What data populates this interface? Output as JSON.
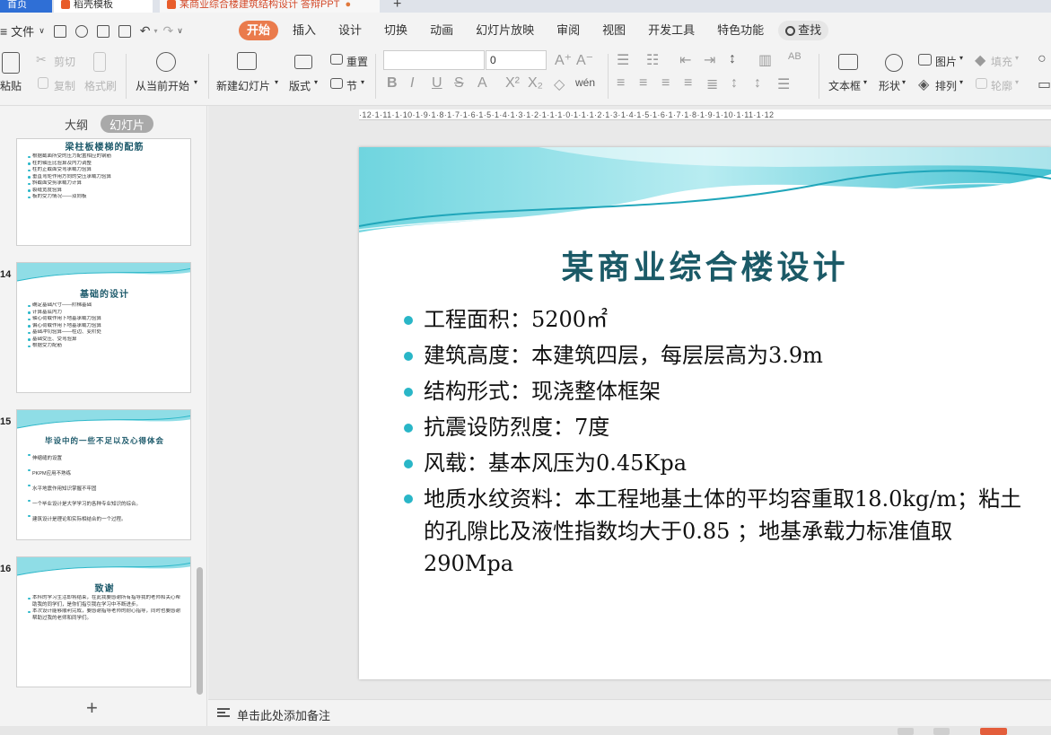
{
  "window": {
    "tabs": [
      {
        "label": "首页"
      },
      {
        "label": "稻壳模板"
      },
      {
        "label": "某商业综合楼建筑结构设计 答辩PPT",
        "modified": "●"
      }
    ],
    "add_tab": "+"
  },
  "menu": {
    "file_label": "文件",
    "tabs": [
      "开始",
      "插入",
      "设计",
      "切换",
      "动画",
      "幻灯片放映",
      "审阅",
      "视图",
      "开发工具",
      "特色功能"
    ],
    "active_tab": "开始",
    "search_label": "查找"
  },
  "ribbon": {
    "paste": "粘贴",
    "cut": "剪切",
    "copy": "复制",
    "format_painter": "格式刷",
    "from_current": "从当前开始",
    "new_slide": "新建幻灯片",
    "layout": "版式",
    "reset": "重置",
    "section": "节",
    "font_size_value": "0",
    "textbox": "文本框",
    "shape": "形状",
    "picture": "图片",
    "fill": "填充",
    "arrange": "排列",
    "outline": "轮廓"
  },
  "left_pane": {
    "tabs": [
      "大纲",
      "幻灯片"
    ],
    "active_tab": "幻灯片",
    "slides": [
      {
        "number": "",
        "title": "梁柱板楼梯的配筋",
        "bullets": [
          "根据截面所受的压力配置相应的钢筋",
          "柱的轴压比验算及内力调整",
          "柱的正截面受弯承载力验算",
          "垂直弯矩作用方向的受压承载力验算",
          "斜截面受剪承载力计算",
          "裂缝宽度验算",
          "板的受力情况——双向板"
        ]
      },
      {
        "number": "14",
        "title": "基础的设计",
        "bullets": [
          "确定基础尺寸——阶梯基础",
          "计算基底内力",
          "轴心荷载作用下地基承载力验算",
          "偏心荷载作用下地基承载力验算",
          "基础冲切验算——柱边、变阶处",
          "基础受压、受弯验算",
          "根据受力配筋"
        ]
      },
      {
        "number": "15",
        "title": "毕设中的一些不足以及心得体会",
        "bullets": [
          "伸缩缝的设置",
          "PKPM应用不熟练",
          "水平地震作用知识掌握不牢固",
          "一个毕业设计是大学学习的各种专业知识的综合。",
          "建筑设计是理论和实际相结合的一个过程。"
        ]
      },
      {
        "number": "16",
        "title": "致谢",
        "bullets": [
          "本科的学习生活即将结束，在此我要感谢所有指导我的老师和关心帮助我的同学们，是你们指引我在学习中不断进步。",
          "本次设计能够顺利完成，要感谢指导老师的耐心指导，同时也要感谢帮助过我的老师和同学们。"
        ]
      }
    ],
    "add_slide": "+"
  },
  "ruler": {
    "ticks": "·12·1·11·1·10·1·9·1·8·1·7·1·6·1·5·1·4·1·3·1·2·1·1·1·0·1·1·1·2·1·3·1·4·1·5·1·6·1·7·1·8·1·9·1·10·1·11·1·12"
  },
  "slide": {
    "title": "某商业综合楼设计",
    "bullets": [
      "工程面积：5200㎡",
      "建筑高度：本建筑四层，每层层高为3.9m",
      "结构形式：现浇整体框架",
      "抗震设防烈度：7度",
      "风载：基本风压为0.45Kpa",
      "地质水纹资料：本工程地基土体的平均容重取18.0kg/m；粘土的孔隙比及液性指数均大于0.85 ；地基承载力标准值取290Mpa"
    ],
    "accent_color": "#29b6c7",
    "title_color": "#1b5a67"
  },
  "notes": {
    "placeholder": "单击此处添加备注"
  }
}
